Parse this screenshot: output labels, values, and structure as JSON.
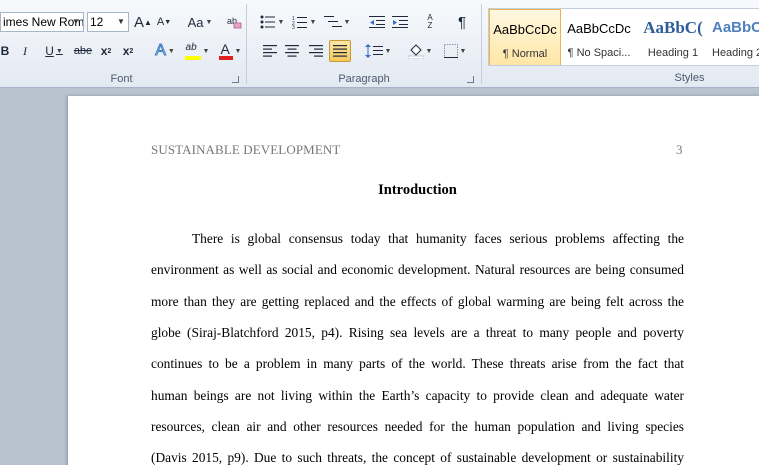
{
  "ribbon": {
    "font_group": {
      "label": "Font",
      "font_name": "imes New Rom",
      "font_size": "12",
      "grow_font": "A",
      "shrink_font": "A",
      "change_case": "Aa",
      "bold": "B",
      "italic": "I",
      "underline": "U",
      "strikethrough": "abe",
      "subscript": "x",
      "superscript": "x",
      "text_effects": "A",
      "highlight": "ab",
      "font_color": "A",
      "highlight_color": "#ffff00",
      "font_color_value": "#e02020"
    },
    "paragraph_group": {
      "label": "Paragraph",
      "sort": "A Z",
      "show_marks": "¶"
    },
    "styles_group": {
      "label": "Styles",
      "items": [
        {
          "sample": "AaBbCcDc",
          "name": "¶ Normal"
        },
        {
          "sample": "AaBbCcDc",
          "name": "¶ No Spaci..."
        },
        {
          "sample": "AaBbC(",
          "name": "Heading 1"
        },
        {
          "sample": "AaBbC",
          "name": "Heading 2"
        }
      ]
    }
  },
  "document": {
    "header": "SUSTAINABLE DEVELOPMENT",
    "page_number": "3",
    "heading": "Introduction",
    "lines": [
      "There is global consensus today that humanity faces serious problems affecting the",
      "environment as well as social and economic development. Natural resources are being consumed",
      "more than they are getting replaced and the effects of global warming are being felt across the",
      "globe (Siraj-Blatchford 2015, p4). Rising sea levels are a threat to many people and poverty",
      "continues to be a problem in many parts of the world. These threats arise from the fact that",
      "human beings are not living within the Earth’s capacity to provide clean and adequate water",
      "resources, clean air and other resources needed for the human population and living species",
      "(Davis 2015, p9). Due to such threats, the concept of sustainable development or sustainability"
    ]
  }
}
